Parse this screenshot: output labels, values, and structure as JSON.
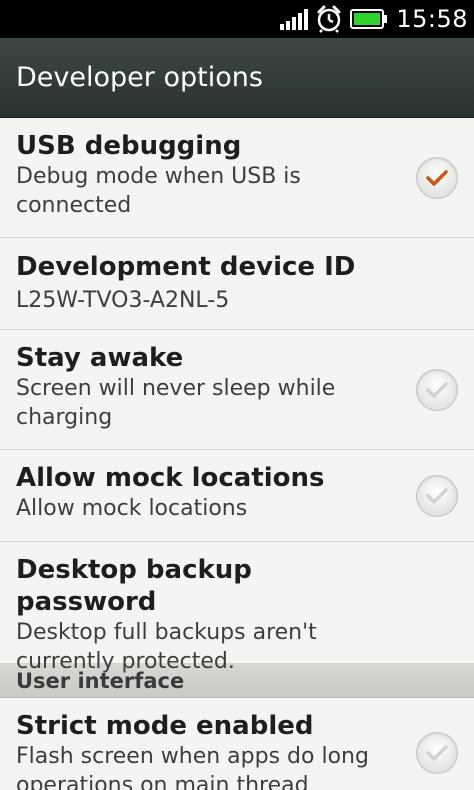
{
  "status_bar": {
    "time": "15:58",
    "icons": [
      "signal-icon",
      "alarm-icon",
      "battery-icon"
    ],
    "battery_color": "#2fd12f"
  },
  "header": {
    "title": "Developer options"
  },
  "preferences": [
    {
      "title": "USB debugging",
      "summary": "Debug mode when USB is connected",
      "checked": true
    },
    {
      "title": "Development device ID",
      "summary": "L25W-TVO3-A2NL-5"
    },
    {
      "title": "Stay awake",
      "summary": "Screen will never sleep while charging",
      "checked": false
    },
    {
      "title": "Allow mock locations",
      "summary": "Allow mock locations",
      "checked": false
    },
    {
      "title": "Desktop backup password",
      "summary": "Desktop full backups aren't currently protected."
    }
  ],
  "sections": [
    {
      "header": "User interface",
      "preferences": [
        {
          "title": "Strict mode enabled",
          "summary": "Flash screen when apps do long operations on main thread",
          "checked": false
        }
      ]
    }
  ],
  "colors": {
    "accent_check": "#d4540f",
    "header_bg": "#333d39"
  }
}
